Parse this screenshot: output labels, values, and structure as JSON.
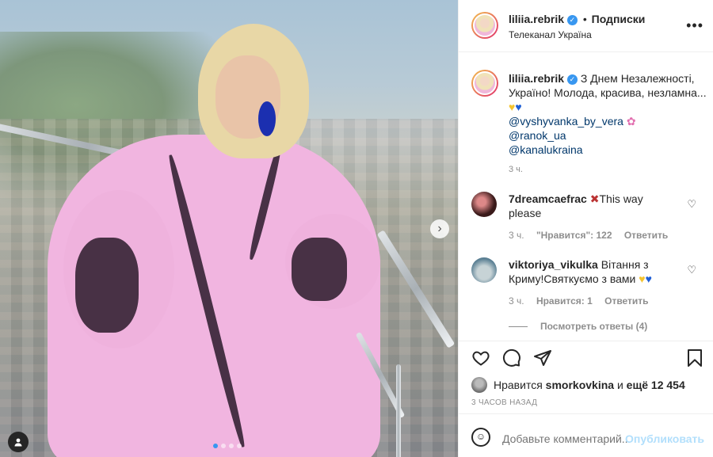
{
  "post": {
    "carousel_next": "›",
    "dots": 4
  },
  "header": {
    "username": "liliia.rebrik",
    "verified_mark": "✓",
    "separator": "•",
    "follow_label": "Подписки",
    "location": "Телеканал Україна",
    "more_icon": "•••"
  },
  "caption": {
    "username": "liliia.rebrik",
    "text": "З Днем Незалежності, Україно! Молода, красива, незламна...",
    "mentions": [
      "@vyshyvanka_by_vera",
      "@ranok_ua",
      "@kanalukraina"
    ],
    "time": "3 ч."
  },
  "comments": [
    {
      "username": "7dreamcaefrac",
      "text": "This way please",
      "emoji": "✖",
      "time": "3 ч.",
      "likes": "\"Нравится\": 122",
      "reply": "Ответить"
    },
    {
      "username": "viktoriya_vikulka",
      "text": "Вітання з Криму!Святкуємо з вами",
      "time": "3 ч.",
      "likes": "Нравится: 1",
      "reply": "Ответить"
    }
  ],
  "replies_label": "Посмотреть ответы (4)",
  "actions": {
    "like_icon": "heart-icon",
    "comment_icon": "comment-icon",
    "share_icon": "share-icon",
    "save_icon": "bookmark-icon"
  },
  "likes": {
    "prefix": "Нравится",
    "user": "smorkovkina",
    "middle": "и",
    "count": "ещё 12 454"
  },
  "posted": "3 ЧАСОВ НАЗАД",
  "add_comment": {
    "placeholder": "Добавьте комментарий...",
    "publish_label": "Опубликовать"
  },
  "colors": {
    "accent": "#3897f0",
    "link": "#00376b",
    "muted": "#8e8e8e",
    "publish_disabled": "#b2dffc"
  }
}
